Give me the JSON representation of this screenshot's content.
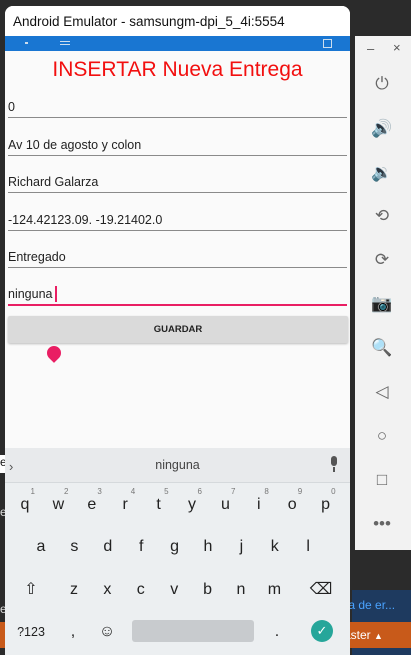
{
  "window": {
    "title": "Android Emulator - samsungm-dpi_5_4i:5554"
  },
  "app": {
    "title": "INSERTAR Nueva Entrega",
    "fields": [
      {
        "value": "0"
      },
      {
        "value": "Av 10 de agosto y colon"
      },
      {
        "value": "Richard Galarza"
      },
      {
        "value": "-124.42123.09.  -19.21402.0"
      },
      {
        "value": "Entregado"
      },
      {
        "value": "ninguna"
      }
    ],
    "save_button": "GUARDAR",
    "accent_color": "#e91e63",
    "title_color": "#f20f0f"
  },
  "keyboard": {
    "suggestion": "ninguna",
    "row1": [
      {
        "key": "q",
        "hint": "1"
      },
      {
        "key": "w",
        "hint": "2"
      },
      {
        "key": "e",
        "hint": "3"
      },
      {
        "key": "r",
        "hint": "4"
      },
      {
        "key": "t",
        "hint": "5"
      },
      {
        "key": "y",
        "hint": "6"
      },
      {
        "key": "u",
        "hint": "7"
      },
      {
        "key": "i",
        "hint": "8"
      },
      {
        "key": "o",
        "hint": "9"
      },
      {
        "key": "p",
        "hint": "0"
      }
    ],
    "row2": [
      "a",
      "s",
      "d",
      "f",
      "g",
      "h",
      "j",
      "k",
      "l"
    ],
    "row3": [
      "z",
      "x",
      "c",
      "v",
      "b",
      "n",
      "m"
    ],
    "symbols_key": "?123",
    "comma_key": ",",
    "period_key": ".",
    "shift_icon": "shift-icon",
    "backspace_icon": "backspace-icon",
    "emoji_icon": "emoji-icon",
    "enter_icon": "check-icon"
  },
  "desktop": {
    "link_text": "ta de er...",
    "taskbar_text": "aster"
  },
  "side_toolbar": {
    "minimize": "–",
    "close": "×",
    "buttons": [
      "power-icon",
      "volume-up-icon",
      "volume-down-icon",
      "rotate-left-icon",
      "rotate-right-icon",
      "camera-icon",
      "zoom-icon",
      "back-icon",
      "home-icon",
      "overview-icon",
      "more-icon"
    ]
  }
}
